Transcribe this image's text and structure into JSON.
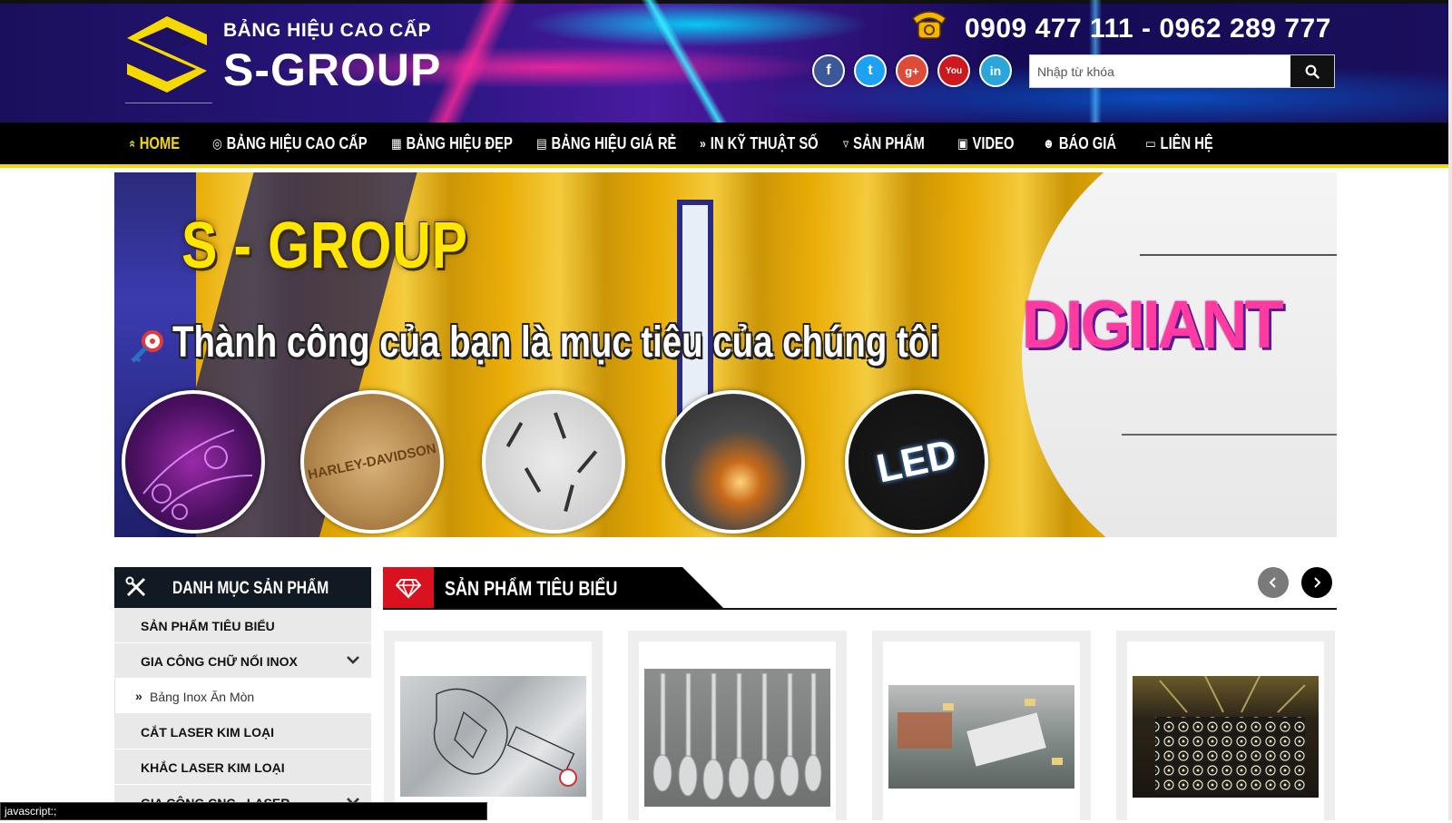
{
  "header": {
    "logo_tagline": "BẢNG HIỆU CAO CẤP",
    "logo_name": "S-GROUP",
    "hotline": "0909 477 111 - 0962 289 777",
    "social": [
      {
        "icon": "facebook-icon",
        "glyph": "f",
        "color": "#3b5998"
      },
      {
        "icon": "twitter-icon",
        "glyph": "t",
        "color": "#1da1f2"
      },
      {
        "icon": "google-plus-icon",
        "glyph": "g+",
        "color": "#dd4b39"
      },
      {
        "icon": "youtube-icon",
        "glyph": "You",
        "color": "#cc181e"
      },
      {
        "icon": "linkedin-icon",
        "glyph": "in",
        "color": "#2aa6d8"
      }
    ],
    "search": {
      "placeholder": "Nhập từ khóa"
    }
  },
  "nav": {
    "items": [
      {
        "label": "HOME",
        "icon": "double-chevron-up-icon",
        "glyph": "»",
        "active": true
      },
      {
        "label": "BẢNG HIỆU CAO CẤP",
        "icon": "globe-icon",
        "glyph": "◎"
      },
      {
        "label": "BẢNG HIỆU ĐẸP",
        "icon": "calendar-icon",
        "glyph": "▦"
      },
      {
        "label": "BẢNG HIỆU GIÁ RẺ",
        "icon": "credit-card-icon",
        "glyph": "▤"
      },
      {
        "label": "IN KỸ THUẬT SỐ",
        "icon": "double-chevron-right-icon",
        "glyph": "»"
      },
      {
        "label": "SẢN PHẨM",
        "icon": "shield-icon",
        "glyph": "▿"
      },
      {
        "label": "VIDEO",
        "icon": "youtube-icon",
        "glyph": "▣"
      },
      {
        "label": "BÁO GIÁ",
        "icon": "users-icon",
        "glyph": "☻"
      },
      {
        "label": "LIÊN HỆ",
        "icon": "money-icon",
        "glyph": "▭"
      }
    ],
    "accent": "#f5d900"
  },
  "banner": {
    "brand": "S - GROUP",
    "slogan": "Thành công của bạn là mục tiêu của chúng tôi",
    "sign_text": "DIGIIANT",
    "circle_labels": [
      "",
      "HARLEY-DAVIDSON",
      "",
      "",
      "LED"
    ]
  },
  "sidebar": {
    "title": "DANH MỤC SẢN PHẨM",
    "items": [
      {
        "label": "SẢN PHẨM TIÊU BIỂU"
      },
      {
        "label": "GIA CÔNG CHỮ NỔI INOX",
        "expandable": true
      },
      {
        "label": "Bảng Inox Ăn Mòn",
        "sub": true
      },
      {
        "label": "CẮT LASER KIM LOẠI"
      },
      {
        "label": "KHẮC LASER KIM LOẠI"
      },
      {
        "label": "GIA CÔNG CNC - LASER",
        "expandable": true
      }
    ]
  },
  "featured": {
    "title": "SẢN PHẨM TIÊU BIỂU",
    "accent": "#d8121f",
    "cards": [
      {
        "image": "engraved-steel-plate"
      },
      {
        "image": "engraved-spoons-forks"
      },
      {
        "image": "laser-marking-machine"
      },
      {
        "image": "laser-cut-metal-panel"
      }
    ]
  },
  "statusbar": {
    "text": "javascript:;"
  }
}
